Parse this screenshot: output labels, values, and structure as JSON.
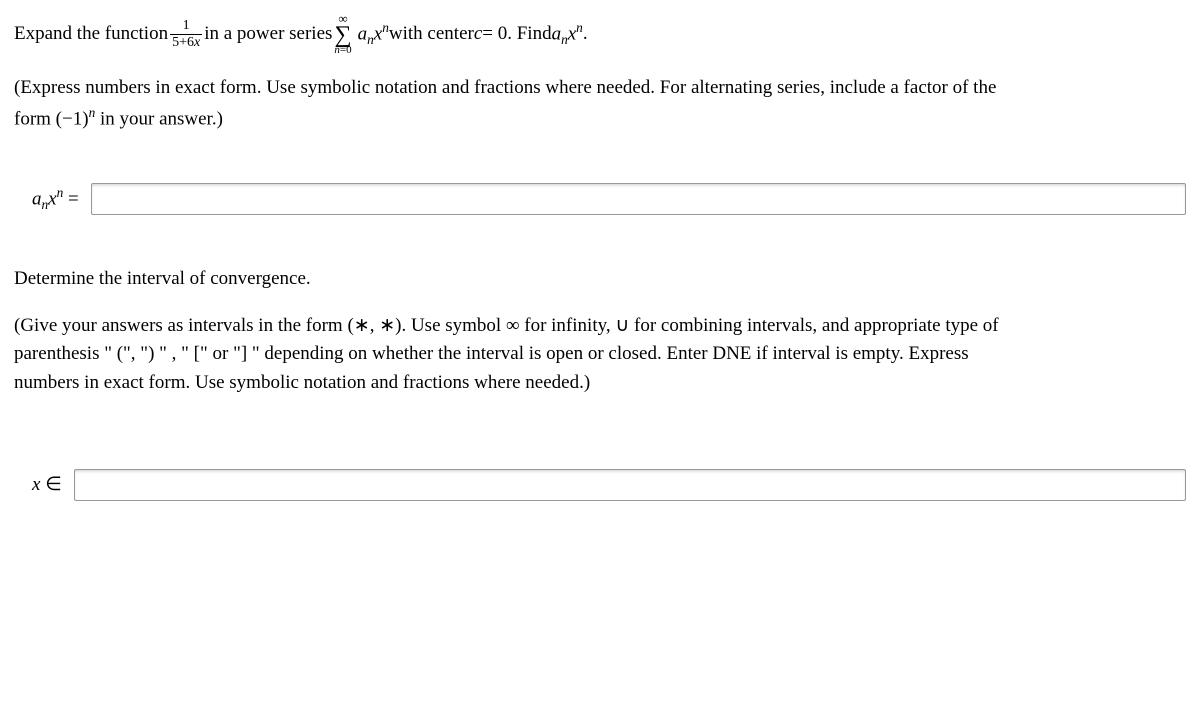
{
  "question1": {
    "prefix": "Expand the function ",
    "frac_num": "1",
    "frac_den": "5+6",
    "frac_den_var": "x",
    "mid1": " in a power series ",
    "sigma_top": "∞",
    "sigma_bottom_var": "n",
    "sigma_bottom_eq": "=0",
    "term_a": "a",
    "term_a_sub": "n",
    "term_x": "x",
    "term_x_sup": "n",
    "mid2": " with center ",
    "c_var": "c",
    "c_eq": " = 0. Find ",
    "find_a": "a",
    "find_a_sub": "n",
    "find_x": "x",
    "find_x_sup": "n",
    "period": "."
  },
  "hint1": {
    "line1a": "(Express numbers in exact form. Use symbolic notation and fractions where needed. For alternating series, include a factor of the",
    "line2a": "form (−1)",
    "line2sup": "n",
    "line2b": " in your answer.)"
  },
  "answer1_label": {
    "a": "a",
    "a_sub": "n",
    "x": "x",
    "x_sup": "n",
    "eq": " ="
  },
  "question2": "Determine the interval of convergence.",
  "hint2": {
    "line1": "(Give your answers as intervals in the form (∗, ∗). Use symbol ∞ for infinity, ∪ for combining intervals, and appropriate type of",
    "line2": "parenthesis \" (\", \") \" ,   \" [\" or  \"] \" depending on whether the interval is open or closed. Enter DNE if interval is empty. Express",
    "line3": "numbers in exact form. Use symbolic notation and fractions where needed.)"
  },
  "answer2_label": {
    "x": "x",
    "in": " ∈"
  }
}
